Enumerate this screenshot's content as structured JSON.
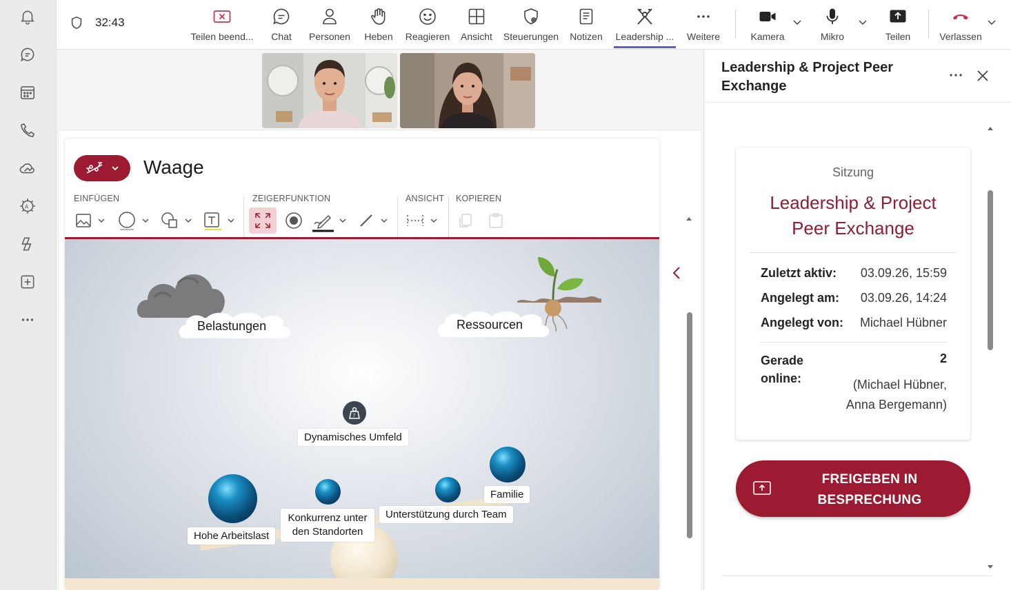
{
  "meeting": {
    "timer": "32:43"
  },
  "toolbar": {
    "items": [
      {
        "label": "Teilen beend..."
      },
      {
        "label": "Chat"
      },
      {
        "label": "Personen"
      },
      {
        "label": "Heben"
      },
      {
        "label": "Reagieren"
      },
      {
        "label": "Ansicht"
      },
      {
        "label": "Steuerungen"
      },
      {
        "label": "Notizen"
      },
      {
        "label": "Leadership ..."
      },
      {
        "label": "Weitere"
      },
      {
        "label": "Kamera"
      },
      {
        "label": "Mikro"
      },
      {
        "label": "Teilen"
      },
      {
        "label": "Verlassen"
      }
    ],
    "active_color": "#5b5fc7",
    "leave_color": "#c4314b",
    "stop_share_color": "#c4314b"
  },
  "participants": [
    "man-video",
    "woman-video"
  ],
  "app": {
    "title": "Waage",
    "accent": "#9c1b32",
    "groups": [
      {
        "label": "EINFÜGEN"
      },
      {
        "label": "ZEIGERFUNKTION"
      },
      {
        "label": "ANSICHT"
      },
      {
        "label": "KOPIEREN"
      }
    ],
    "canvas": {
      "burden_label": "Belastungen",
      "resource_label": "Ressourcen",
      "center_label": "Dynamisches Umfeld",
      "items": [
        {
          "label": "Hohe Arbeitslast"
        },
        {
          "label": "Konkurrenz unter den Standorten"
        },
        {
          "label": "Unterstützung durch Team"
        },
        {
          "label": "Familie"
        }
      ]
    }
  },
  "panel": {
    "title": "Leadership & Project Peer Exchange",
    "session_label": "Sitzung",
    "session_name": "Leadership & Project Peer Exchange",
    "rows": [
      {
        "key": "Zuletzt aktiv:",
        "value": "03.09.26, 15:59"
      },
      {
        "key": "Angelegt am:",
        "value": "03.09.26, 14:24"
      },
      {
        "key": "Angelegt von:",
        "value": "Michael Hübner"
      }
    ],
    "online_key": "Gerade online:",
    "online_count": "2",
    "online_names": [
      "(Michael Hübner,",
      "Anna Bergemann)"
    ],
    "share_button": "FREIGEBEN IN BESPRECHUNG"
  }
}
